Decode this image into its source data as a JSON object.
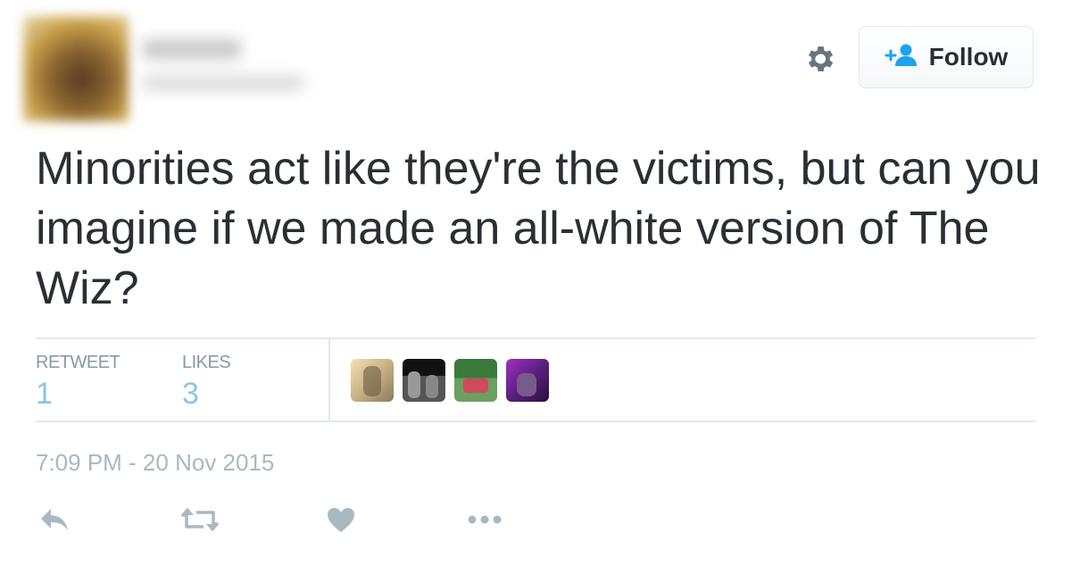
{
  "header": {
    "follow_label": "Follow",
    "icons": {
      "settings": "gear-icon",
      "follow": "follow-person-icon"
    }
  },
  "tweet": {
    "text": "Minorities act like they're the victims, but can you imagine if we made an all-white version of The Wiz?"
  },
  "stats": {
    "retweets_label": "RETWEET",
    "retweets_count": "1",
    "likes_label": "LIKES",
    "likes_count": "3"
  },
  "timestamp": "7:09 PM - 20 Nov 2015",
  "actions": [
    "reply-icon",
    "retweet-icon",
    "like-icon",
    "more-icon"
  ],
  "colors": {
    "text": "#292f33",
    "muted": "#8899a6",
    "count": "#8ec3e6",
    "accent": "#1da1f2",
    "action_icon": "#aab8c2"
  }
}
